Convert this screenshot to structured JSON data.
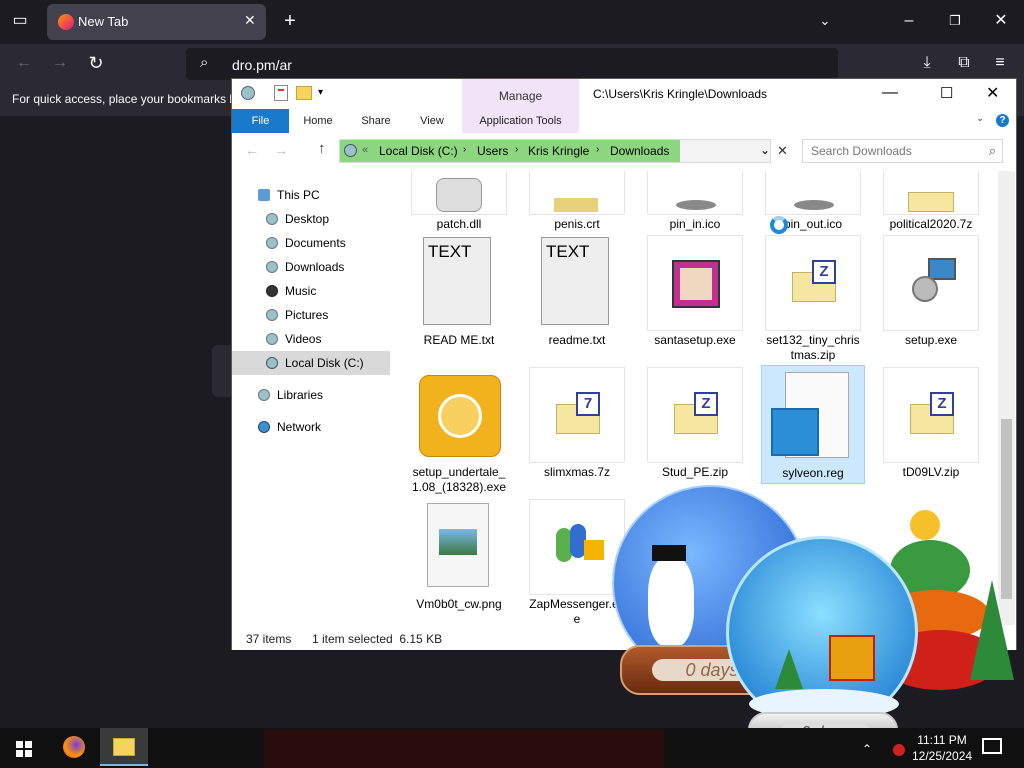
{
  "browser": {
    "tab_title": "New Tab",
    "url": "dro.pm/ar",
    "bookmarks_hint": "For quick access, place your bookmarks h"
  },
  "explorer": {
    "title_path": "C:\\Users\\Kris Kringle\\Downloads",
    "contextual_group": "Manage",
    "ribbon_tabs": [
      "File",
      "Home",
      "Share",
      "View",
      "Application Tools"
    ],
    "breadcrumb": [
      "Local Disk (C:)",
      "Users",
      "Kris Kringle",
      "Downloads"
    ],
    "search_placeholder": "Search Downloads",
    "nav": [
      "This PC",
      "Desktop",
      "Documents",
      "Downloads",
      "Music",
      "Pictures",
      "Videos",
      "Local Disk (C:)",
      "Libraries",
      "Network"
    ],
    "files": [
      "patch.dll",
      "penis.crt",
      "pin_in.ico",
      "pin_out.ico",
      "political2020.7z",
      "READ ME.txt",
      "readme.txt",
      "santasetup.exe",
      "set132_tiny_christmas.zip",
      "setup.exe",
      "setup_undertale_1.08_(18328).exe",
      "slimxmas.7z",
      "Stud_PE.zip",
      "sylveon.reg",
      "tD09LV.zip",
      "Vm0b0t_cw.png",
      "ZapMessenger.exe"
    ],
    "status_items": "37 items",
    "status_selected": "1 item selected  6.15 KB",
    "text_icon_label": "TEXT",
    "zip_letter": "Z",
    "sevenz_letter": "7"
  },
  "desktop": {
    "globe_label": "0 days"
  },
  "taskbar": {
    "time": "11:11 PM",
    "date": "12/25/2024"
  }
}
